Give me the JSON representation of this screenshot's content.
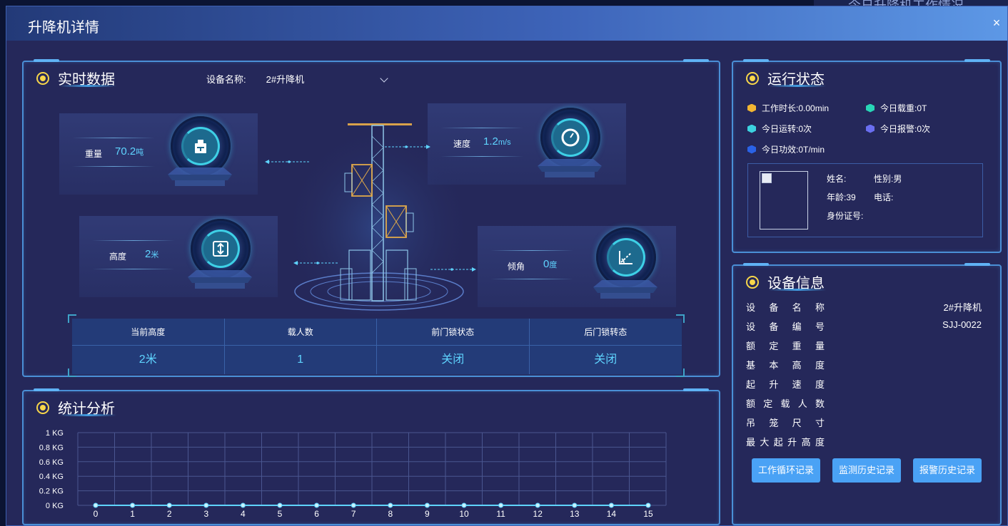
{
  "background": {
    "title": "今日升降机工作情况"
  },
  "modal": {
    "title": "升降机详情",
    "close": "×"
  },
  "realtime": {
    "title": "实时数据",
    "device_label": "设备名称:",
    "device_value": "2#升降机",
    "weight": {
      "label": "重量",
      "value": "70.2",
      "unit": "吨"
    },
    "speed": {
      "label": "速度",
      "value": "1.2",
      "unit": "m/s"
    },
    "height": {
      "label": "高度",
      "value": "2",
      "unit": "米"
    },
    "tilt": {
      "label": "倾角",
      "value": "0",
      "unit": "度"
    },
    "table": {
      "headers": [
        "当前高度",
        "载人数",
        "前门锁状态",
        "后门锁转态"
      ],
      "values": [
        "2米",
        "1",
        "关闭",
        "关闭"
      ]
    }
  },
  "stats": {
    "title": "统计分析",
    "chart_data": {
      "type": "line",
      "x": [
        0,
        1,
        2,
        3,
        4,
        5,
        6,
        7,
        8,
        9,
        10,
        11,
        12,
        13,
        14,
        15
      ],
      "series": [
        {
          "values": [
            0,
            0,
            0,
            0,
            0,
            0,
            0,
            0,
            0,
            0,
            0,
            0,
            0,
            0,
            0,
            0
          ]
        }
      ],
      "ylim": [
        0,
        1
      ],
      "yticks": [
        "0 KG",
        "0.2 KG",
        "0.4 KG",
        "0.6 KG",
        "0.8 KG",
        "1 KG"
      ],
      "grid": true,
      "line_color": "#5fd4ff"
    }
  },
  "run_status": {
    "title": "运行状态",
    "items": [
      {
        "label": "工作时长:",
        "value": "0.00min",
        "color": "#f2b632"
      },
      {
        "label": "今日载重:",
        "value": "0T",
        "color": "#28d6b6"
      },
      {
        "label": "今日运转:",
        "value": "0次",
        "color": "#3cd2e0"
      },
      {
        "label": "今日报警:",
        "value": "0次",
        "color": "#6a6ef0"
      },
      {
        "label": "今日功效:",
        "value": "0T/min",
        "color": "#2a62e6"
      }
    ],
    "person": {
      "name_label": "姓名:",
      "name": "",
      "gender_label": "性别:",
      "gender": "男",
      "age_label": "年龄:",
      "age": "39",
      "phone_label": "电话:",
      "phone": "",
      "id_label": "身份证号:",
      "id": ""
    }
  },
  "device_info": {
    "title": "设备信息",
    "rows": [
      {
        "key": "设备名称",
        "value": "2#升降机"
      },
      {
        "key": "设备编号",
        "value": "SJJ-0022"
      },
      {
        "key": "额定重量",
        "value": ""
      },
      {
        "key": "基本高度",
        "value": ""
      },
      {
        "key": "起升速度",
        "value": ""
      },
      {
        "key": "额定载人数",
        "value": ""
      },
      {
        "key": "吊笼尺寸",
        "value": ""
      },
      {
        "key": "最大起升高度",
        "value": ""
      }
    ],
    "buttons": [
      "工作循环记录",
      "监测历史记录",
      "报警历史记录"
    ]
  }
}
